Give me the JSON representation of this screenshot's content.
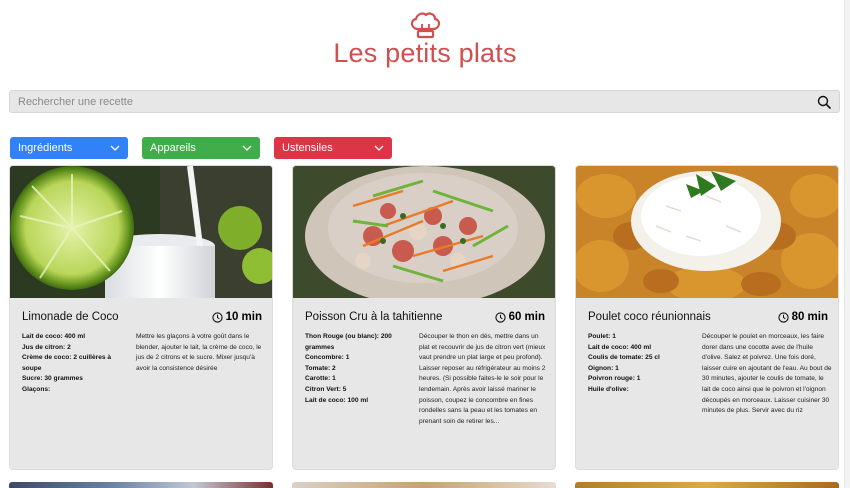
{
  "header": {
    "title": "Les petits plats",
    "logo_icon": "chef-hat-icon"
  },
  "search": {
    "placeholder": "Rechercher une recette",
    "value": ""
  },
  "filters": [
    {
      "label": "Ingrédients",
      "color": "#3282f7"
    },
    {
      "label": "Appareils",
      "color": "#3fae4a"
    },
    {
      "label": "Ustensiles",
      "color": "#dc3545"
    }
  ],
  "recipes": [
    {
      "name": "Limonade de Coco",
      "time": "10 min",
      "ingredients": [
        {
          "name": "Lait de coco:",
          "qty": "400 ml"
        },
        {
          "name": "Jus de citron:",
          "qty": "2"
        },
        {
          "name": "Crème de coco:",
          "qty": "2 cuillères à soupe"
        },
        {
          "name": "Sucre:",
          "qty": "30 grammes"
        },
        {
          "name": "Glaçons:",
          "qty": ""
        }
      ],
      "description": "Mettre les glaçons à votre goût dans le blender, ajouter le lait, la crème de coco, le jus de 2 citrons et le sucre. Mixer jusqu'à avoir la consistence désirée"
    },
    {
      "name": "Poisson Cru à la tahitienne",
      "time": "60 min",
      "ingredients": [
        {
          "name": "Thon Rouge (ou blanc):",
          "qty": "200 grammes"
        },
        {
          "name": "Concombre:",
          "qty": "1"
        },
        {
          "name": "Tomate:",
          "qty": "2"
        },
        {
          "name": "Carotte:",
          "qty": "1"
        },
        {
          "name": "Citron Vert:",
          "qty": "5"
        },
        {
          "name": "Lait de coco:",
          "qty": "100 ml"
        }
      ],
      "description": "Découper le thon en dés, mettre dans un plat et recouvrir de jus de citron vert (mieux vaut prendre un plat large et peu profond). Laisser reposer au réfrigérateur au moins 2 heures. (Si possible faites-le le soir pour le lendemain. Après avoir laissé mariner le poisson, coupez le concombre en fines rondelles sans la peau et les tomates en prenant soin de retirer les..."
    },
    {
      "name": "Poulet coco réunionnais",
      "time": "80 min",
      "ingredients": [
        {
          "name": "Poulet:",
          "qty": "1"
        },
        {
          "name": "Lait de coco:",
          "qty": "400 ml"
        },
        {
          "name": "Coulis de tomate:",
          "qty": "25 cl"
        },
        {
          "name": "Oignon:",
          "qty": "1"
        },
        {
          "name": "Poivron rouge:",
          "qty": "1"
        },
        {
          "name": "Huile d'olive:",
          "qty": ""
        }
      ],
      "description": "Découper le poulet en morceaux, les faire dorer dans une cocotte avec de l'huile d'olive. Salez et poivrez. Une fois doré, laisser cuire en ajoutant de l'eau. Au bout de 30 minutes, ajouter le coulis de tomate, le lait de coco ainsi que le poivron et l'oignon découpés en morceaux. Laisser cuisiner 30 minutes de plus. Servir avec du riz"
    }
  ]
}
